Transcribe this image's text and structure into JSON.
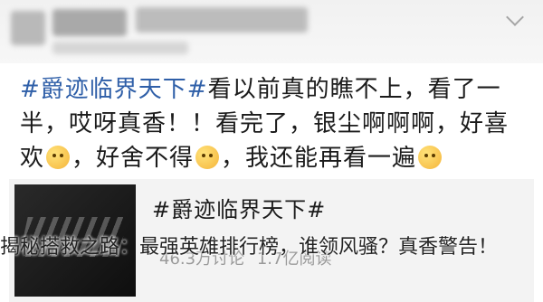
{
  "post": {
    "hashtag": "#爵迹临界天下#",
    "line1_rest": "看以前真的瞧不上，看了一",
    "line2": "半，哎呀真香！！看完了，银尘啊啊啊，好喜",
    "line3_a": "欢",
    "line3_b": "，好舍不得",
    "line3_c": "，我还能再看一遍",
    "emojis": [
      "smiling-face-icon",
      "crying-face-icon",
      "smiling-face-icon"
    ]
  },
  "card": {
    "title": "#爵迹临界天下#",
    "stats": {
      "discussions": "46.3万讨论",
      "reads": "1.7亿阅读"
    }
  },
  "caption": {
    "text": "揭秘搭救之路：最强英雄排行榜，谁领风骚？真香警告！"
  }
}
